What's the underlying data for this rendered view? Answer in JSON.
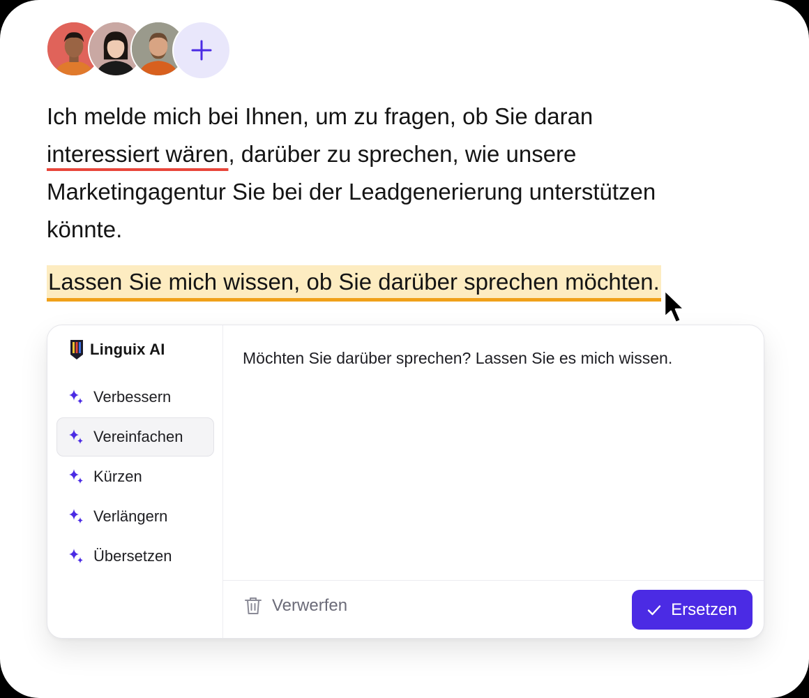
{
  "collaborators": {
    "avatars": [
      "avatar-1",
      "avatar-2",
      "avatar-3"
    ],
    "add_icon": "plus-icon"
  },
  "document": {
    "para1_before": "Ich melde mich bei Ihnen, um zu fragen, ob Sie daran ",
    "para1_flagged": "interessiert wären",
    "para1_after": ", darüber zu sprechen, wie unsere Marketingagentur Sie bei der Leadgenerierung unterstützen könnte.",
    "selected_sentence": "Lassen Sie mich wissen, ob Sie darüber sprechen möchten."
  },
  "assistant": {
    "brand": "Linguix AI",
    "menu": [
      {
        "label": "Verbessern",
        "icon": "sparkle-icon"
      },
      {
        "label": "Vereinfachen",
        "icon": "sparkle-icon",
        "active": true
      },
      {
        "label": "Kürzen",
        "icon": "sparkle-icon"
      },
      {
        "label": "Verlängern",
        "icon": "sparkle-icon"
      },
      {
        "label": "Übersetzen",
        "icon": "sparkle-icon"
      }
    ],
    "suggestion": "Möchten Sie darüber sprechen? Lassen Sie es mich wissen.",
    "discard_label": "Verwerfen",
    "replace_label": "Ersetzen"
  },
  "colors": {
    "accent": "#4b2be4",
    "flag_underline": "#e8463b",
    "highlight_fill": "#fdecc1",
    "highlight_underline": "#f0a11a"
  }
}
